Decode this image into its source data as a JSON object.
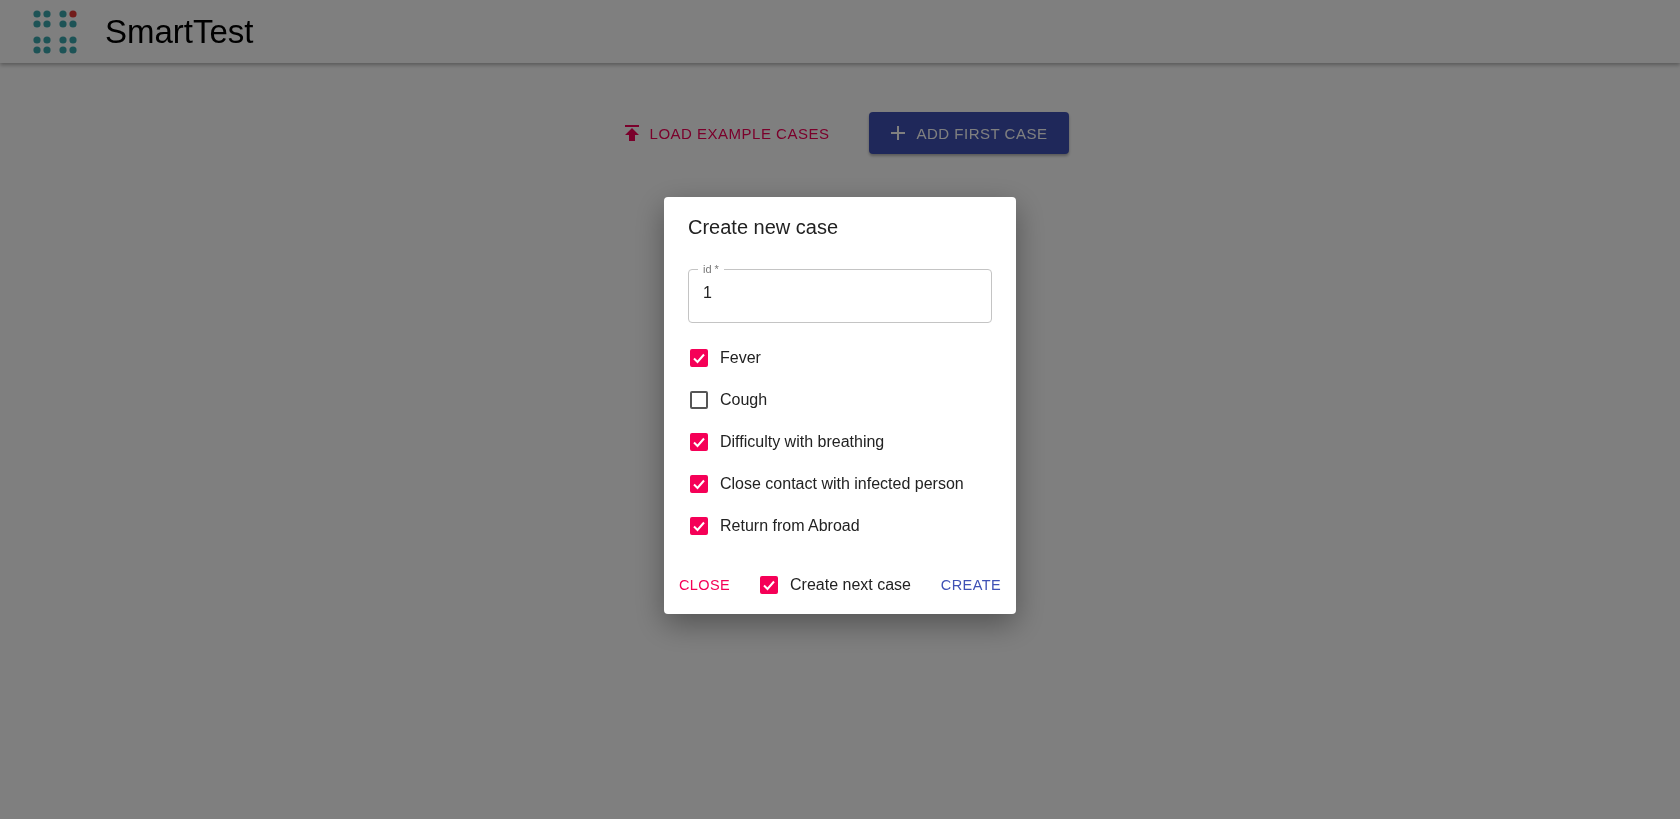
{
  "app_bar": {
    "title": "SmartTest"
  },
  "actions": [
    {
      "kind": "text",
      "label": "LOAD EXAMPLE CASES"
    },
    {
      "kind": "contained",
      "label": "ADD FIRST CASE"
    }
  ],
  "dialog": {
    "title": "Create new case",
    "field": {
      "label": "id *",
      "value": "1"
    },
    "checkboxes": [
      {
        "label": "Fever",
        "checked": true
      },
      {
        "label": "Cough",
        "checked": false
      },
      {
        "label": "Difficulty with breathing",
        "checked": true
      },
      {
        "label": "Close contact with infected person",
        "checked": true
      },
      {
        "label": "Return from Abroad",
        "checked": true
      }
    ],
    "close_button": "CLOSE",
    "next_case": {
      "label": "Create next case",
      "checked": true
    },
    "create_button": "CREATE"
  }
}
